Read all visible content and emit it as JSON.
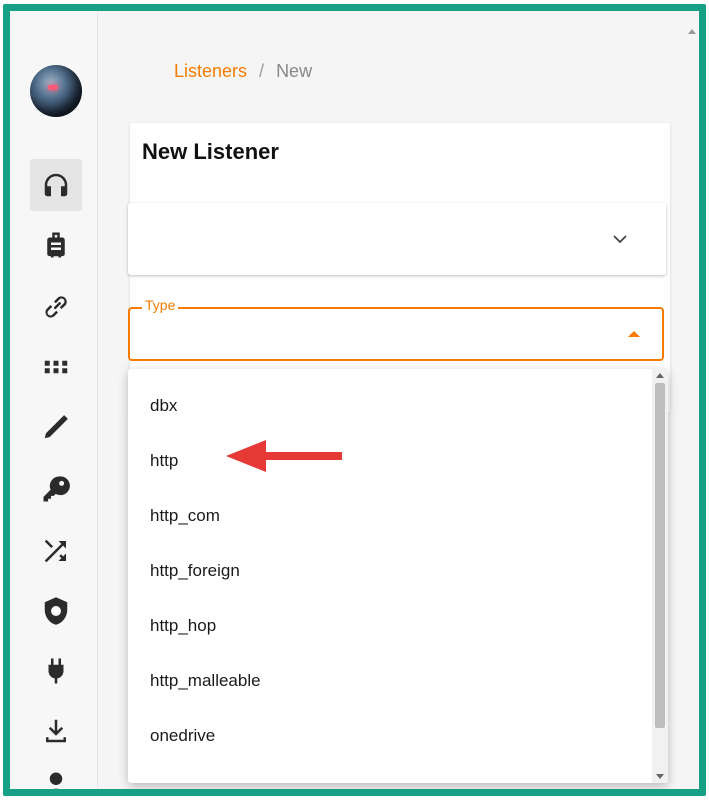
{
  "breadcrumb": {
    "listeners_label": "Listeners",
    "separator": "/",
    "current_label": "New"
  },
  "page": {
    "title": "New Listener"
  },
  "type_field": {
    "label": "Type",
    "value": ""
  },
  "dropdown": {
    "options": [
      "dbx",
      "http",
      "http_com",
      "http_foreign",
      "http_hop",
      "http_malleable",
      "onedrive"
    ]
  },
  "sidebar": {
    "items": [
      {
        "icon": "headphones-icon",
        "active": true
      },
      {
        "icon": "luggage-icon"
      },
      {
        "icon": "link-icon"
      },
      {
        "icon": "apps-grid-icon"
      },
      {
        "icon": "pen-icon"
      },
      {
        "icon": "key-icon"
      },
      {
        "icon": "shuffle-icon"
      },
      {
        "icon": "shield-gear-icon"
      },
      {
        "icon": "plug-icon"
      },
      {
        "icon": "download-icon"
      },
      {
        "icon": "user-icon"
      }
    ]
  },
  "colors": {
    "accent": "#f57c00",
    "frame": "#16a085",
    "annotation_arrow": "#e53935"
  }
}
